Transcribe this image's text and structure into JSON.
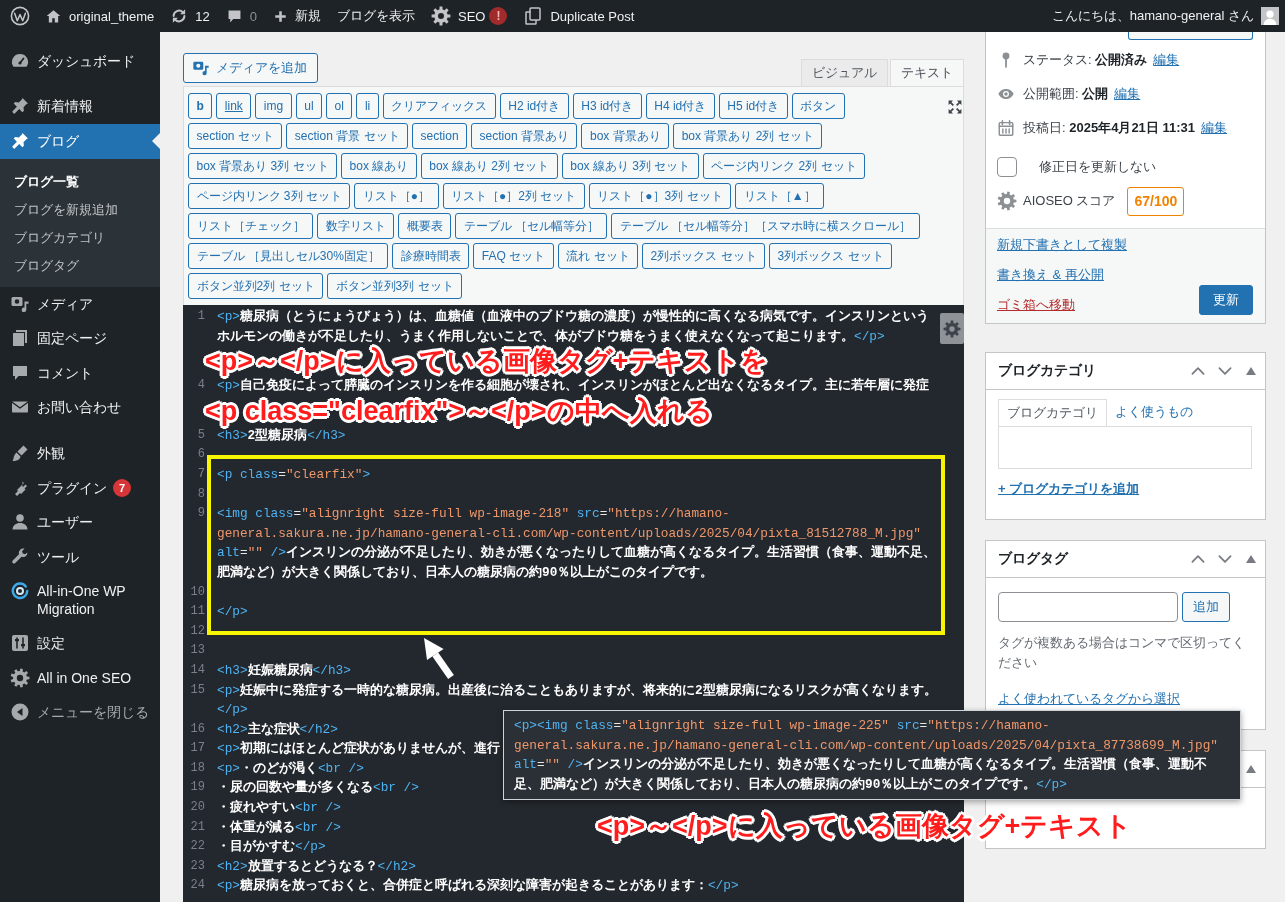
{
  "admin_bar": {
    "site": "original_theme",
    "updates": "12",
    "comments": "0",
    "new": "新規",
    "view": "ブログを表示",
    "seo": "SEO",
    "seo_alert": "!",
    "duplicate": "Duplicate Post",
    "greeting": "こんにちは、hamano-general さん"
  },
  "sidebar": {
    "groups": [
      {
        "items": [
          {
            "label": "ダッシュボード",
            "selected": false
          }
        ]
      },
      {
        "items": [
          {
            "label": "新着情報",
            "selected": false
          },
          {
            "label": "ブログ",
            "selected": true,
            "children": [
              {
                "label": "ブログ一覧",
                "selected": true
              },
              {
                "label": "ブログを新規追加",
                "selected": false
              },
              {
                "label": "ブログカテゴリ",
                "selected": false
              },
              {
                "label": "ブログタグ",
                "selected": false
              }
            ]
          },
          {
            "label": "メディア",
            "selected": false
          },
          {
            "label": "固定ページ",
            "selected": false
          },
          {
            "label": "コメント",
            "selected": false
          },
          {
            "label": "お問い合わせ",
            "selected": false
          }
        ]
      },
      {
        "items": [
          {
            "label": "外観",
            "selected": false
          },
          {
            "label": "プラグイン",
            "selected": false,
            "badge": "7"
          },
          {
            "label": "ユーザー",
            "selected": false
          },
          {
            "label": "ツール",
            "selected": false
          },
          {
            "label": "All-in-One WP Migration",
            "selected": false
          },
          {
            "label": "設定",
            "selected": false
          },
          {
            "label": "All in One SEO",
            "selected": false
          }
        ]
      }
    ],
    "collapse": "メニューを閉じる"
  },
  "editor": {
    "media_button": "メディアを追加",
    "tabs": [
      {
        "label": "ビジュアル",
        "selected": false
      },
      {
        "label": "テキスト",
        "selected": true
      }
    ],
    "quicktags": [
      {
        "label": "b",
        "kind": "bold"
      },
      {
        "label": "link",
        "kind": "link"
      },
      {
        "label": "img",
        "kind": "plain"
      },
      {
        "label": "ul",
        "kind": "plain"
      },
      {
        "label": "ol",
        "kind": "plain"
      },
      {
        "label": "li",
        "kind": "plain"
      },
      {
        "label": "クリアフィックス",
        "kind": "plain"
      },
      {
        "label": "H2 id付き",
        "kind": "plain"
      },
      {
        "label": "H3 id付き",
        "kind": "plain"
      },
      {
        "label": "H4 id付き",
        "kind": "plain"
      },
      {
        "label": "H5 id付き",
        "kind": "plain"
      },
      {
        "label": "ボタン",
        "kind": "plain"
      },
      {
        "label": "section セット",
        "kind": "plain"
      },
      {
        "label": "section 背景 セット",
        "kind": "plain"
      },
      {
        "label": "section",
        "kind": "plain"
      },
      {
        "label": "section 背景あり",
        "kind": "plain"
      },
      {
        "label": "box 背景あり",
        "kind": "plain"
      },
      {
        "label": "box 背景あり 2列 セット",
        "kind": "plain"
      },
      {
        "label": "box 背景あり 3列 セット",
        "kind": "plain"
      },
      {
        "label": "box 線あり",
        "kind": "plain"
      },
      {
        "label": "box 線あり 2列 セット",
        "kind": "plain"
      },
      {
        "label": "box 線あり 3列 セット",
        "kind": "plain"
      },
      {
        "label": "ページ内リンク 2列 セット",
        "kind": "plain"
      },
      {
        "label": "ページ内リンク 3列 セット",
        "kind": "plain"
      },
      {
        "label": "リスト［●］",
        "kind": "plain"
      },
      {
        "label": "リスト［●］2列 セット",
        "kind": "plain"
      },
      {
        "label": "リスト［●］3列 セット",
        "kind": "plain"
      },
      {
        "label": "リスト［▲］",
        "kind": "plain"
      },
      {
        "label": "リスト［チェック］",
        "kind": "plain"
      },
      {
        "label": "数字リスト",
        "kind": "plain"
      },
      {
        "label": "概要表",
        "kind": "plain"
      },
      {
        "label": "テーブル ［セル幅等分］",
        "kind": "plain"
      },
      {
        "label": "テーブル ［セル幅等分］［スマホ時に横スクロール］",
        "kind": "plain"
      },
      {
        "label": "テーブル ［見出しセル30%固定］",
        "kind": "plain"
      },
      {
        "label": "診療時間表",
        "kind": "plain"
      },
      {
        "label": "FAQ セット",
        "kind": "plain"
      },
      {
        "label": "流れ セット",
        "kind": "plain"
      },
      {
        "label": "2列ボックス セット",
        "kind": "plain"
      },
      {
        "label": "3列ボックス セット",
        "kind": "plain"
      },
      {
        "label": "ボタン並列2列 セット",
        "kind": "plain"
      },
      {
        "label": "ボタン並列3列 セット",
        "kind": "plain"
      }
    ],
    "rows": [
      {
        "kind": "line",
        "number": "1",
        "code": "<p>糖尿病（とうにょうびょう）は、血糖値（血液中のブドウ糖の濃度）が慢性的に高くなる病気です。インスリンというホルモンの働きが不足したり、うまく作用しないことで、体がブドウ糖をうまく使えなくなって起こります。</p>"
      },
      {
        "kind": "note",
        "text": "<p>～</p>に入っている画像タグ+テキストを"
      },
      {
        "kind": "line",
        "number": "4",
        "code": "<p>自己免疫によって膵臓のインスリンを作る細胞が壊され、インスリンがほとんど出なくなるタイプ。主に若年層に発症"
      },
      {
        "kind": "note",
        "text": "<p class=\"clearfix\">～</p>の中へ入れる"
      },
      {
        "kind": "line",
        "number": "5",
        "code": "<h3>2型糖尿病</h3>"
      },
      {
        "kind": "line",
        "number": "6"
      },
      {
        "kind": "highlight",
        "children": [
          {
            "kind": "line",
            "number": "7",
            "code": "<p class=\"clearfix\">"
          },
          {
            "kind": "line",
            "number": "8"
          },
          {
            "kind": "line",
            "number": "9",
            "code": "<img class=\"alignright size-full wp-image-218\" src=\"https://hamano-general.sakura.ne.jp/hamano-general-cli.com/wp-content/uploads/2025/04/pixta_81512788_M.jpg\" alt=\"\" />インスリンの分泌が不足したり、効きが悪くなったりして血糖が高くなるタイプ。生活習慣（食事、運動不足、肥満など）が大きく関係しており、日本人の糖尿病の約90％以上がこのタイプです。"
          },
          {
            "kind": "line",
            "number": "10"
          },
          {
            "kind": "line",
            "number": "11",
            "code": "</p>"
          },
          {
            "kind": "line",
            "number": "12"
          }
        ]
      },
      {
        "kind": "line",
        "number": "13"
      },
      {
        "kind": "line",
        "number": "14",
        "code": "<h3>妊娠糖尿病</h3>"
      },
      {
        "kind": "line",
        "number": "15",
        "code": "<p>妊娠中に発症する一時的な糖尿病。出産後に治ることもありますが、将来的に2型糖尿病になるリスクが高くなります。</p>"
      },
      {
        "kind": "line",
        "number": "16",
        "code": "<h2>主な症状</h2>"
      },
      {
        "kind": "line",
        "number": "17",
        "code": "<p>初期にはほとんど症状がありませんが、進行"
      },
      {
        "kind": "line",
        "number": "18",
        "code": "<p>・のどが渇く<br />"
      },
      {
        "kind": "line",
        "number": "19",
        "code": "・尿の回数や量が多くなる<br />"
      },
      {
        "kind": "line",
        "number": "20",
        "code": "・疲れやすい<br />"
      },
      {
        "kind": "line",
        "number": "21",
        "code": "・体重が減る<br />"
      },
      {
        "kind": "line",
        "number": "22",
        "code": "・目がかすむ</p>"
      },
      {
        "kind": "line",
        "number": "23",
        "code": "<h2>放置するとどうなる？</h2>"
      },
      {
        "kind": "line",
        "number": "24",
        "code": "<p>糖尿病を放っておくと、合併症と呼ばれる深刻な障害が起きることがあります：</p>"
      }
    ]
  },
  "callout": {
    "code": "<p><img class=\"alignright size-full wp-image-225\" src=\"https://hamano-general.sakura.ne.jp/hamano-general-cli.com/wp-content/uploads/2025/04/pixta_87738699_M.jpg\" alt=\"\" />インスリンの分泌が不足したり、効きが悪くなったりして血糖が高くなるタイプ。生活習慣（食事、運動不足、肥満など）が大きく関係しており、日本人の糖尿病の約90％以上がこのタイプです。</p>",
    "note": "<p>～</p>に入っている画像タグ+テキスト"
  },
  "publish_box": {
    "meta": [
      {
        "text": "ステータス: **公開済み**",
        "link": "編集"
      },
      {
        "text": "公開範囲: **公開**",
        "link": "編集"
      },
      {
        "text": "投稿日: **2025年4月21日 11:31**",
        "link": "編集"
      }
    ],
    "keep_date": {
      "label": "修正日を更新しない",
      "checked": false
    },
    "seo": {
      "label": "AIOSEO スコア",
      "score": "67/100"
    },
    "links": [
      {
        "label": "新規下書きとして複製",
        "kind": "link"
      },
      {
        "label": "書き換え & 再公開",
        "kind": "link"
      },
      {
        "label": "ゴミ箱へ移動",
        "kind": "delete"
      }
    ],
    "update": "更新"
  },
  "category_box": {
    "title": "ブログカテゴリ",
    "tabs": [
      {
        "label": "ブログカテゴリ",
        "selected": true
      },
      {
        "label": "よく使うもの",
        "selected": false
      }
    ],
    "add_link": "+ ブログカテゴリを追加"
  },
  "tag_box": {
    "title": "ブログタグ",
    "add_button": "追加",
    "help": "タグが複数ある場合はコンマで区切ってください",
    "choose_link": "よく使われているタグから選択"
  }
}
